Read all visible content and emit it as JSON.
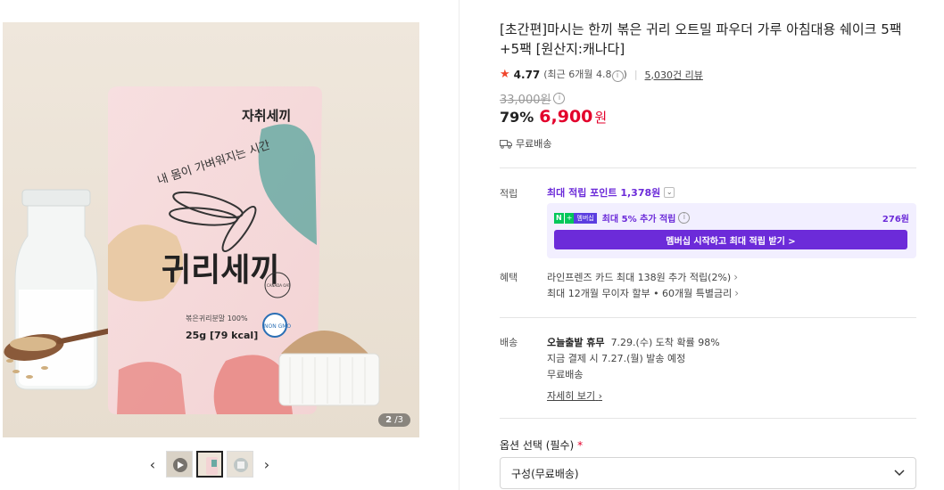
{
  "product": {
    "title": "[초간편]마시는 한끼 볶은 귀리 오트밀 파우더 가루 아침대용 쉐이크 5팩+5팩 [원산지:캐나다]",
    "rating": "4.77",
    "rating_recent": "(최근 6개월 4.8",
    "rating_recent_close": ")",
    "review_count": "5,030건 리뷰",
    "original_price": "33,000원",
    "discount_rate": "79%",
    "sale_price": "6,900",
    "currency": "원",
    "shipping": "무료배송"
  },
  "gallery": {
    "current": "2",
    "total": "/3",
    "package_brand": "자취세끼",
    "package_slogan": "내 몸이 가벼워지는 시간",
    "package_name": "귀리세끼",
    "package_sub": "볶은귀리분말 100%",
    "package_weight": "25g [79 kcal]",
    "badge_text": "NON GMO",
    "seal_text": "CANADA OAT"
  },
  "points": {
    "label": "적립",
    "max_points": "최대 적립 포인트 1,378원",
    "npay_n": "N",
    "npay_plus": "+",
    "npay_member": "멤버십",
    "extra_text": "최대 5% 추가 적립",
    "extra_points": "276원",
    "membership_button": "멤버십 시작하고 최대 적립 받기 >"
  },
  "benefits": {
    "label": "혜택",
    "item1": "라인프렌즈 카드 최대 138원 추가 적립(2%)",
    "item2": "최대 12개월 무이자 할부 • 60개월 특별금리"
  },
  "delivery": {
    "label": "배송",
    "line1_bold": "오늘출발 휴무",
    "line1_rest": "7.29.(수) 도착 확률 98%",
    "line2": "지금 결제 시 7.27.(월) 발송 예정",
    "line3": "무료배송",
    "detail_link": "자세히 보기"
  },
  "option": {
    "label": "옵션 선택 (필수)",
    "required_mark": "*",
    "selected": "구성(무료배송)"
  },
  "icons": {
    "star": "star-icon",
    "info": "info-icon",
    "truck": "truck-icon",
    "chevron": "chevron-right-icon",
    "dropdown": "chevron-down-icon",
    "play": "play-icon"
  },
  "colors": {
    "sale": "#e3002b",
    "accent": "#6c2bd9",
    "star": "#f0452c",
    "npay_green": "#03c75a"
  }
}
